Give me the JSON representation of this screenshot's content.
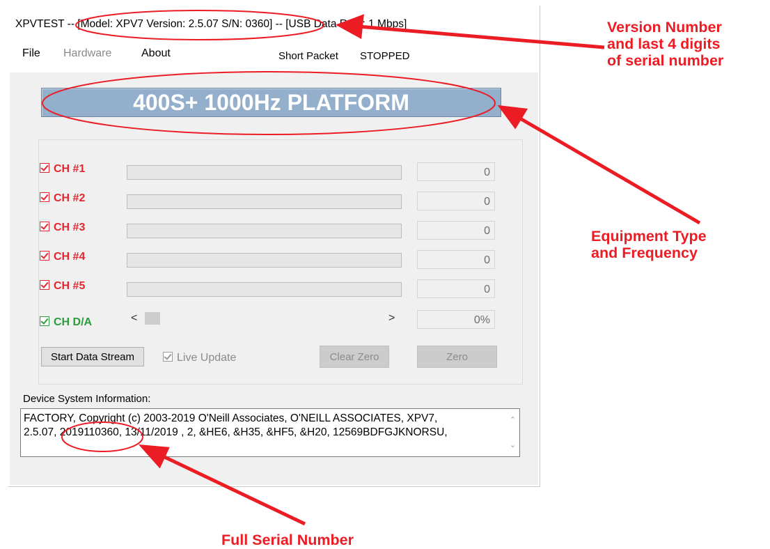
{
  "window": {
    "title": "XPVTEST -- [Model: XPV7 Version: 2.5.07 S/N: 0360] -- [USB Data Rate: 1 Mbps]"
  },
  "menu": {
    "file": "File",
    "hardware": "Hardware",
    "about": "About",
    "packet": "Short Packet",
    "state": "STOPPED"
  },
  "banner": "400S+  1000Hz PLATFORM",
  "channels": [
    {
      "label": "CH #1",
      "value": "0",
      "level": 0
    },
    {
      "label": "CH #2",
      "value": "0",
      "level": 0
    },
    {
      "label": "CH #3",
      "value": "0",
      "level": 0
    },
    {
      "label": "CH #4",
      "value": "0",
      "level": 0
    },
    {
      "label": "CH #5",
      "value": "0",
      "level": 0
    }
  ],
  "da": {
    "label": "CH D/A",
    "value": "0%",
    "scroll_left": "<",
    "scroll_right": ">"
  },
  "buttons": {
    "start": "Start Data Stream",
    "live": "Live Update",
    "clear_zero": "Clear Zero",
    "zero": "Zero"
  },
  "device": {
    "label": "Device System Information:",
    "line1": "FACTORY, Copyright (c) 2003-2019 O'Neill Associates, O'NEILL ASSOCIATES, XPV7,",
    "line2": "2.5.07, 2019110360, 13/11/2019  , 2, &HE6, &H35, &HF5, &H20, 12569BDFGJKNORSU,"
  },
  "annotations": {
    "version_l1": "Version Number",
    "version_l2": "and last 4 digits",
    "version_l3": "of serial number",
    "equip_l1": "Equipment Type",
    "equip_l2": "and Frequency",
    "serial": "Full Serial Number"
  },
  "colors": {
    "annotation": "#ec1c24",
    "channel": "#e3262f",
    "da": "#2a9d3b",
    "banner": "#94afcb"
  }
}
